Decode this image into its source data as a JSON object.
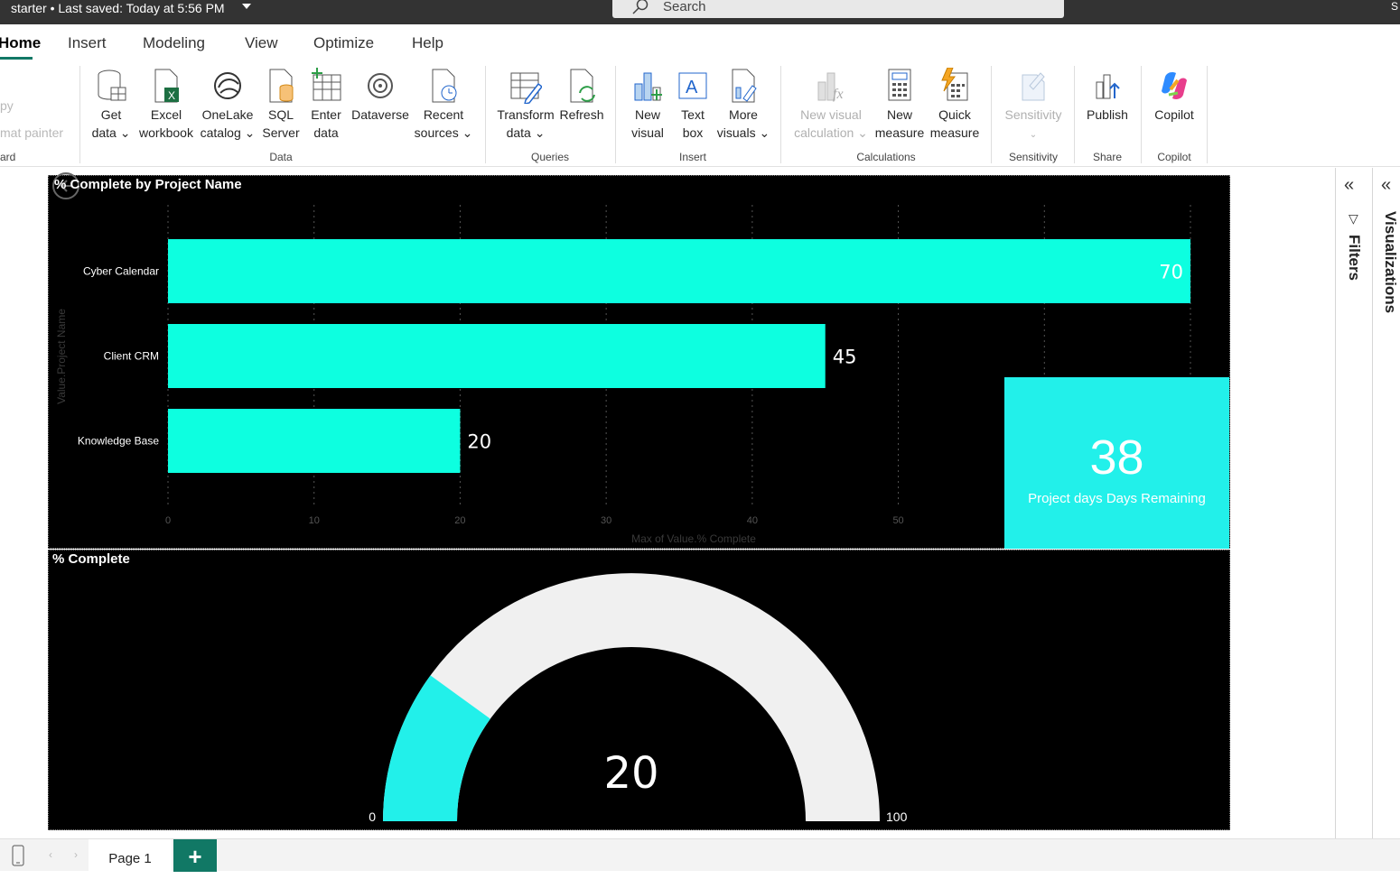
{
  "titlebar": {
    "file": "starter",
    "saved": "Last saved: Today at 5:56 PM",
    "right_fragment": "S"
  },
  "search": {
    "placeholder": "Search"
  },
  "tabs": [
    "Home",
    "Insert",
    "Modeling",
    "View",
    "Optimize",
    "Help"
  ],
  "clipboard": {
    "copy": "py",
    "format_painter": "mat painter",
    "group": "ard"
  },
  "ribbon": {
    "data": [
      {
        "l1": "Get",
        "l2": "data ⌄"
      },
      {
        "l1": "Excel",
        "l2": "workbook"
      },
      {
        "l1": "OneLake",
        "l2": "catalog ⌄"
      },
      {
        "l1": "SQL",
        "l2": "Server"
      },
      {
        "l1": "Enter",
        "l2": "data"
      },
      {
        "l1": "Dataverse",
        "l2": ""
      },
      {
        "l1": "Recent",
        "l2": "sources ⌄"
      }
    ],
    "queries": [
      {
        "l1": "Transform",
        "l2": "data ⌄"
      },
      {
        "l1": "Refresh",
        "l2": ""
      }
    ],
    "insert": [
      {
        "l1": "New",
        "l2": "visual"
      },
      {
        "l1": "Text",
        "l2": "box"
      },
      {
        "l1": "More",
        "l2": "visuals ⌄"
      }
    ],
    "calculations": [
      {
        "l1": "New visual",
        "l2": "calculation ⌄"
      },
      {
        "l1": "New",
        "l2": "measure"
      },
      {
        "l1": "Quick",
        "l2": "measure"
      }
    ],
    "sensitivity": {
      "l1": "Sensitivity",
      "l2": "⌄"
    },
    "share": {
      "l1": "Publish"
    },
    "copilot": {
      "l1": "Copilot"
    },
    "groups": {
      "data": "Data",
      "queries": "Queries",
      "insert": "Insert",
      "calculations": "Calculations",
      "sensitivity": "Sensitivity",
      "share": "Share",
      "copilot": "Copilot"
    }
  },
  "visual_bar": {
    "title": "% Complete by Project Name"
  },
  "card": {
    "value": "38",
    "label": "Project days Days Remaining"
  },
  "visual_gauge": {
    "title": "% Complete"
  },
  "panels": {
    "filters": "Filters",
    "visualizations": "Visualizations"
  },
  "footer": {
    "page_tab": "Page 1",
    "add": "+"
  },
  "colors": {
    "bar": "#0dffe0",
    "card": "#22f0ea",
    "gauge_fill": "#22f0ea",
    "gauge_track": "#f0f0f0",
    "accent": "#117865"
  },
  "chart_data": [
    {
      "type": "bar",
      "orientation": "horizontal",
      "categories": [
        "Cyber Calendar",
        "Client CRM",
        "Knowledge Base"
      ],
      "values": [
        70,
        45,
        20
      ],
      "xlabel": "Max of Value.% Complete",
      "ylabel": "Value.Project Name",
      "xlim": [
        0,
        70
      ],
      "xticks": [
        0,
        10,
        20,
        30,
        40,
        50
      ],
      "grid": true
    },
    {
      "type": "gauge",
      "value": 20,
      "min": 0,
      "max": 100,
      "min_label": "0",
      "max_label": "100",
      "value_label": "20"
    }
  ]
}
